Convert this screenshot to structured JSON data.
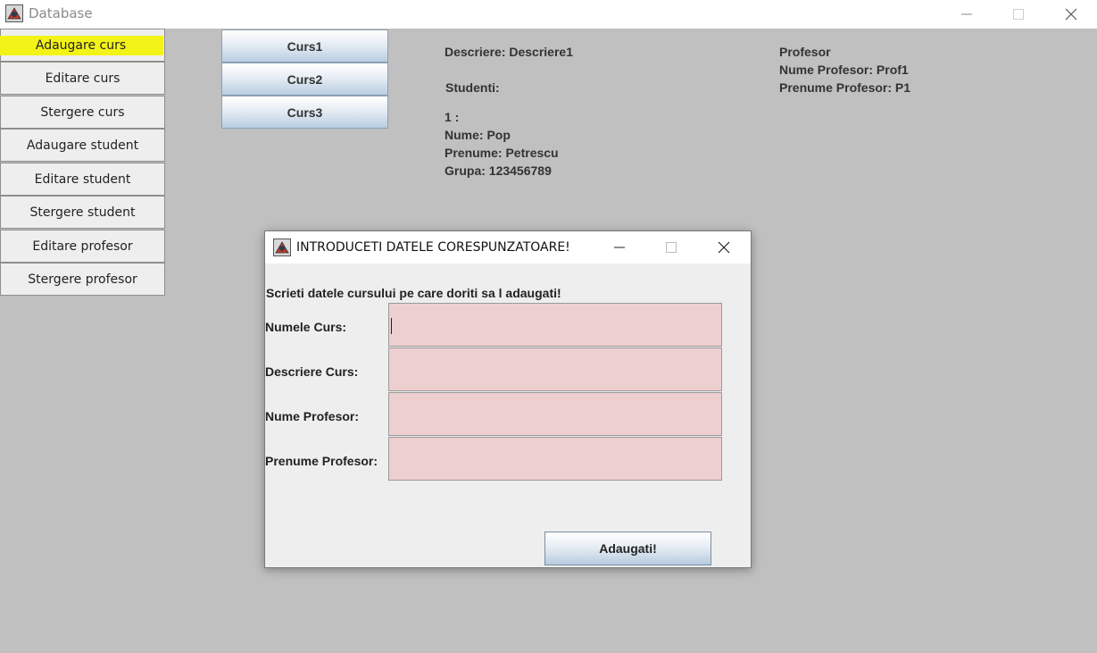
{
  "window": {
    "title": "Database"
  },
  "sidebar": {
    "items": [
      {
        "label": "Adaugare curs"
      },
      {
        "label": "Editare curs"
      },
      {
        "label": "Stergere curs"
      },
      {
        "label": "Adaugare student"
      },
      {
        "label": "Editare student"
      },
      {
        "label": "Stergere student"
      },
      {
        "label": "Editare profesor"
      },
      {
        "label": "Stergere profesor"
      }
    ]
  },
  "courses": [
    {
      "label": "Curs1"
    },
    {
      "label": "Curs2"
    },
    {
      "label": "Curs3"
    }
  ],
  "details": {
    "description": "Descriere: Descriere1",
    "students_heading": "Studenti:",
    "student": {
      "index": "1 :",
      "nume": "Nume: Pop",
      "prenume": "Prenume: Petrescu",
      "grupa": "Grupa: 123456789"
    },
    "profesor": {
      "heading": "Profesor",
      "nume": "Nume Profesor: Prof1",
      "prenume": "Prenume Profesor: P1"
    }
  },
  "dialog": {
    "title": "INTRODUCETI DATELE CORESPUNZATOARE!",
    "instruction": "Scrieti datele cursului pe care doriti sa l adaugati!",
    "fields": [
      {
        "label": "Numele Curs:",
        "value": ""
      },
      {
        "label": "Descriere Curs:",
        "value": ""
      },
      {
        "label": "Nume Profesor:",
        "value": ""
      },
      {
        "label": "Prenume Profesor:",
        "value": ""
      }
    ],
    "submit_label": "Adaugati!"
  },
  "colors": {
    "background": "#c0c0c0",
    "highlight": "#f3f318",
    "input_background": "#eecfcf"
  }
}
